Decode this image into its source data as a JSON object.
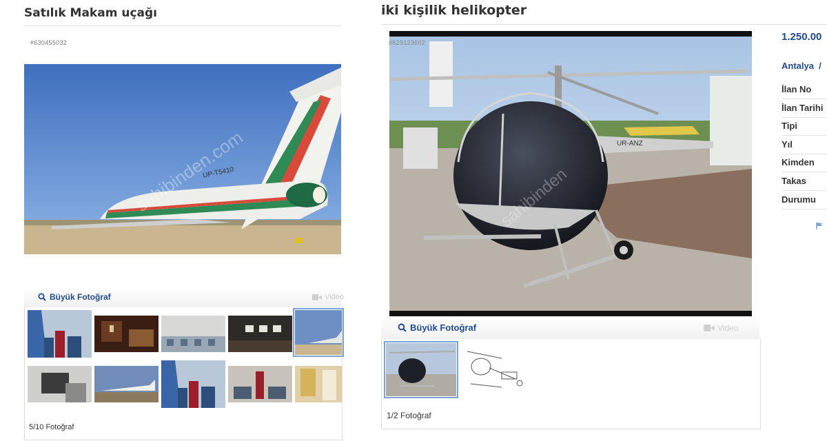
{
  "left": {
    "title": "Satılık Makam uçağı",
    "listing_id": "#630455032",
    "big_photo_label": "Büyük Fotoğraf",
    "video_label": "Video",
    "photo_count": "5/10 Fotoğraf",
    "watermark": "sahibinden.com",
    "registration": "UP-T5410"
  },
  "right": {
    "title": "iki kişilik helikopter",
    "listing_id": "#629123602",
    "big_photo_label": "Büyük Fotoğraf",
    "video_label": "Video",
    "photo_count": "1/2 Fotoğraf",
    "price": "1.250.00",
    "location": "Antalya  /",
    "info_labels": [
      "İlan No",
      "İlan Tarihi",
      "Tipi",
      "Yıl",
      "Kimden",
      "Takas",
      "Durumu"
    ],
    "registration": "UR-ANZ",
    "watermark": "sahibinden"
  },
  "colors": {
    "link_blue": "#1e4b8f",
    "flag_blue": "#7da0cc"
  }
}
